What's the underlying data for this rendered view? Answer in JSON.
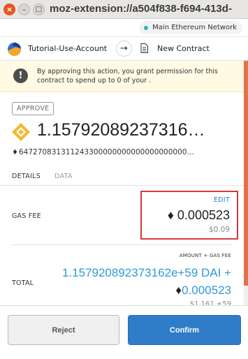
{
  "window": {
    "title": "moz-extension://a504f838-f694-413d-",
    "close_glyph": "×",
    "minimize_glyph": "–",
    "maximize_glyph": "□"
  },
  "network": {
    "label": "Main Ethereum Network",
    "dot_color": "#29b6af"
  },
  "account": {
    "name": "Tutorial-Use-Account",
    "arrow_glyph": "→",
    "recipient": "New Contract"
  },
  "warning": {
    "icon_glyph": "!",
    "text": "By approving this action, you grant permission for this contract to spend up to 0 of your ."
  },
  "transaction": {
    "type_tag": "APPROVE",
    "amount": "1.15792089237316…",
    "eth_glyph": "♦",
    "eth_amount": "647270831311243300000000000000000000…"
  },
  "tabs": {
    "details": "DETAILS",
    "data": "DATA",
    "active": "details"
  },
  "details": {
    "gas_fee_label": "GAS FEE",
    "edit_label": "EDIT",
    "gas_eth": "0.000523",
    "gas_fiat": "$0.09",
    "amount_gas_label": "AMOUNT + GAS FEE",
    "total_label": "TOTAL",
    "total_line1": "1.157920892373162e+59 DAI +",
    "total_line2": "0.000523",
    "total_fiat": "$1.161 +59"
  },
  "footer": {
    "reject_label": "Reject",
    "confirm_label": "Confirm"
  },
  "colors": {
    "accent_blue": "#2f7dc9",
    "total_blue": "#3099d8",
    "warning_bg": "#fefae3",
    "highlight_box": "#d23a3a",
    "scroll_thumb": "#e4714e"
  }
}
